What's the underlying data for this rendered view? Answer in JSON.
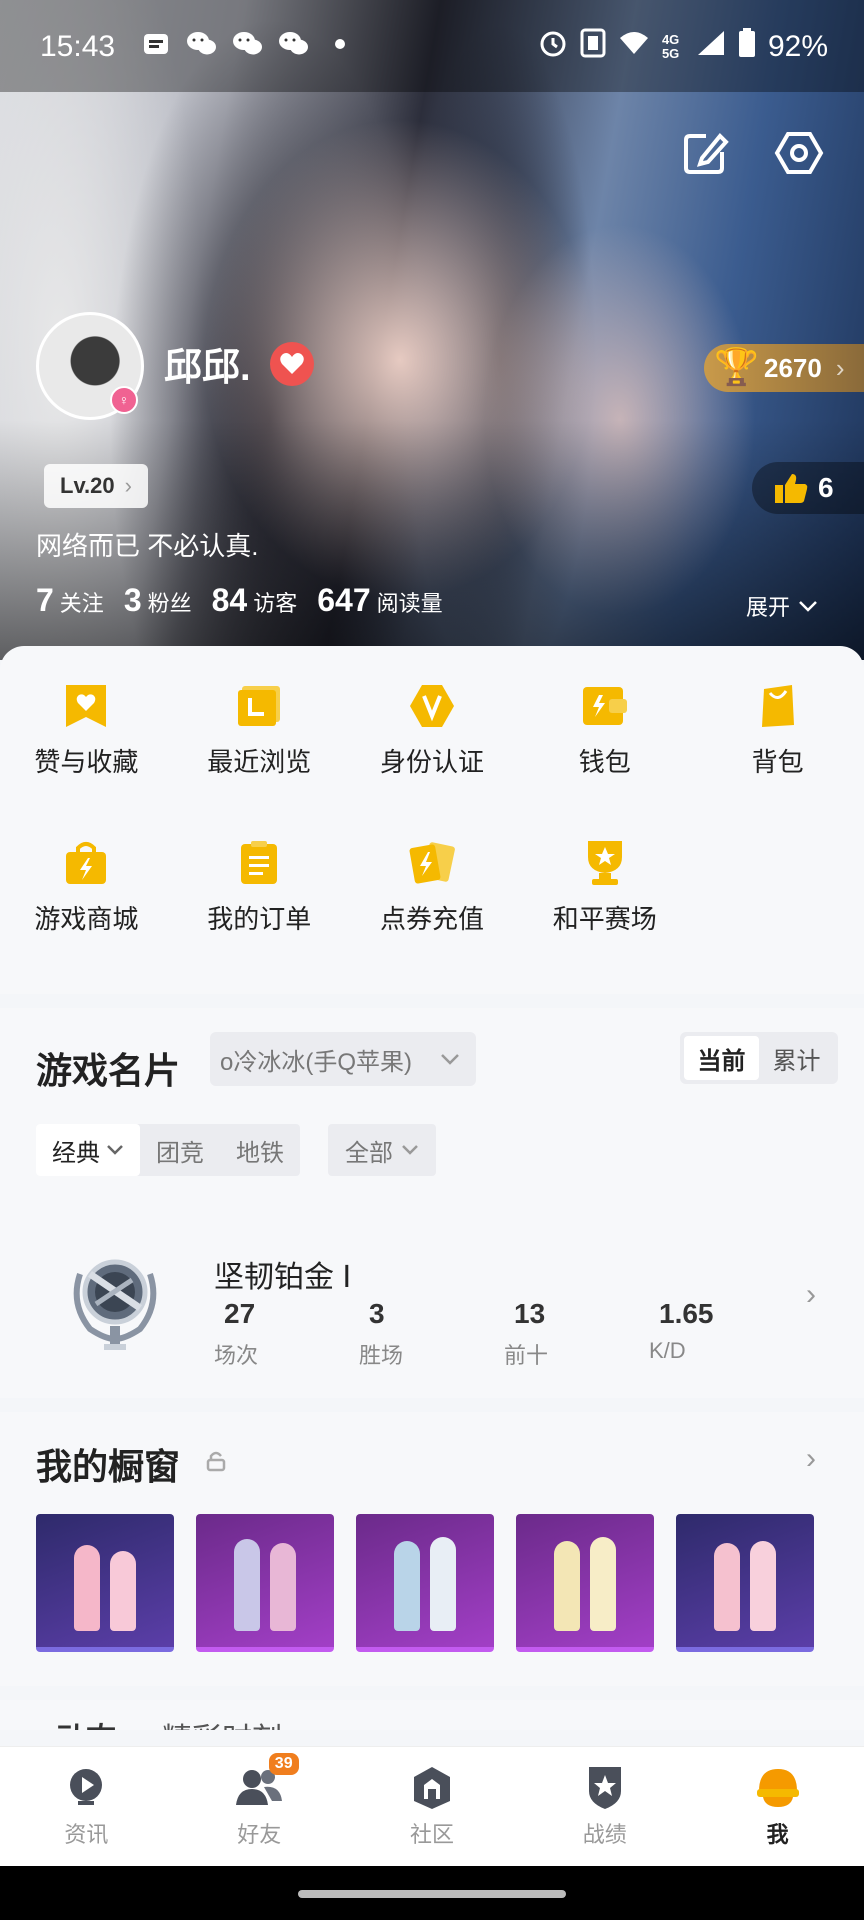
{
  "status_bar": {
    "time": "15:43",
    "network": "4G 5G",
    "battery": "92%",
    "app_icons": [
      "message-icon",
      "wechat-icon",
      "wechat-icon",
      "wechat-icon"
    ]
  },
  "profile": {
    "username": "邱邱.",
    "level": "Lv.20",
    "bio": "网络而已 不必认真.",
    "trophy_score": "2670",
    "likes": "6",
    "expand_label": "展开",
    "stats": [
      {
        "value": "7",
        "label": "关注"
      },
      {
        "value": "3",
        "label": "粉丝"
      },
      {
        "value": "84",
        "label": "访客"
      },
      {
        "value": "647",
        "label": "阅读量"
      }
    ]
  },
  "menu": {
    "items": [
      {
        "label": "赞与收藏",
        "icon": "favorites-icon"
      },
      {
        "label": "最近浏览",
        "icon": "history-icon"
      },
      {
        "label": "身份认证",
        "icon": "verify-icon"
      },
      {
        "label": "钱包",
        "icon": "wallet-icon"
      },
      {
        "label": "背包",
        "icon": "backpack-icon"
      },
      {
        "label": "游戏商城",
        "icon": "shop-icon"
      },
      {
        "label": "我的订单",
        "icon": "orders-icon"
      },
      {
        "label": "点券充值",
        "icon": "recharge-icon"
      },
      {
        "label": "和平赛场",
        "icon": "arena-icon"
      }
    ],
    "accent_color": "#f5b900"
  },
  "game_card": {
    "title": "游戏名片",
    "account": "o冷冰冰(手Q苹果)",
    "toggle": [
      "当前",
      "累计"
    ],
    "mode_tabs": [
      "经典",
      "团竞",
      "地铁"
    ],
    "filter": "全部",
    "rank_name": "坚韧铂金 Ⅰ",
    "rank_stats": [
      {
        "value": "27",
        "label": "场次"
      },
      {
        "value": "3",
        "label": "胜场"
      },
      {
        "value": "13",
        "label": "前十"
      },
      {
        "value": "1.65",
        "label": "K/D"
      }
    ]
  },
  "showcase": {
    "title": "我的橱窗",
    "items": [
      "outfit-1",
      "outfit-2",
      "outfit-3",
      "outfit-4",
      "outfit-5"
    ]
  },
  "peek": {
    "tabs": [
      "动态",
      "精彩时刻"
    ]
  },
  "bottom_nav": {
    "items": [
      {
        "label": "资讯",
        "icon": "news-icon"
      },
      {
        "label": "好友",
        "icon": "friends-icon",
        "badge": "39"
      },
      {
        "label": "社区",
        "icon": "community-icon"
      },
      {
        "label": "战绩",
        "icon": "records-icon"
      },
      {
        "label": "我",
        "icon": "me-icon"
      }
    ]
  }
}
